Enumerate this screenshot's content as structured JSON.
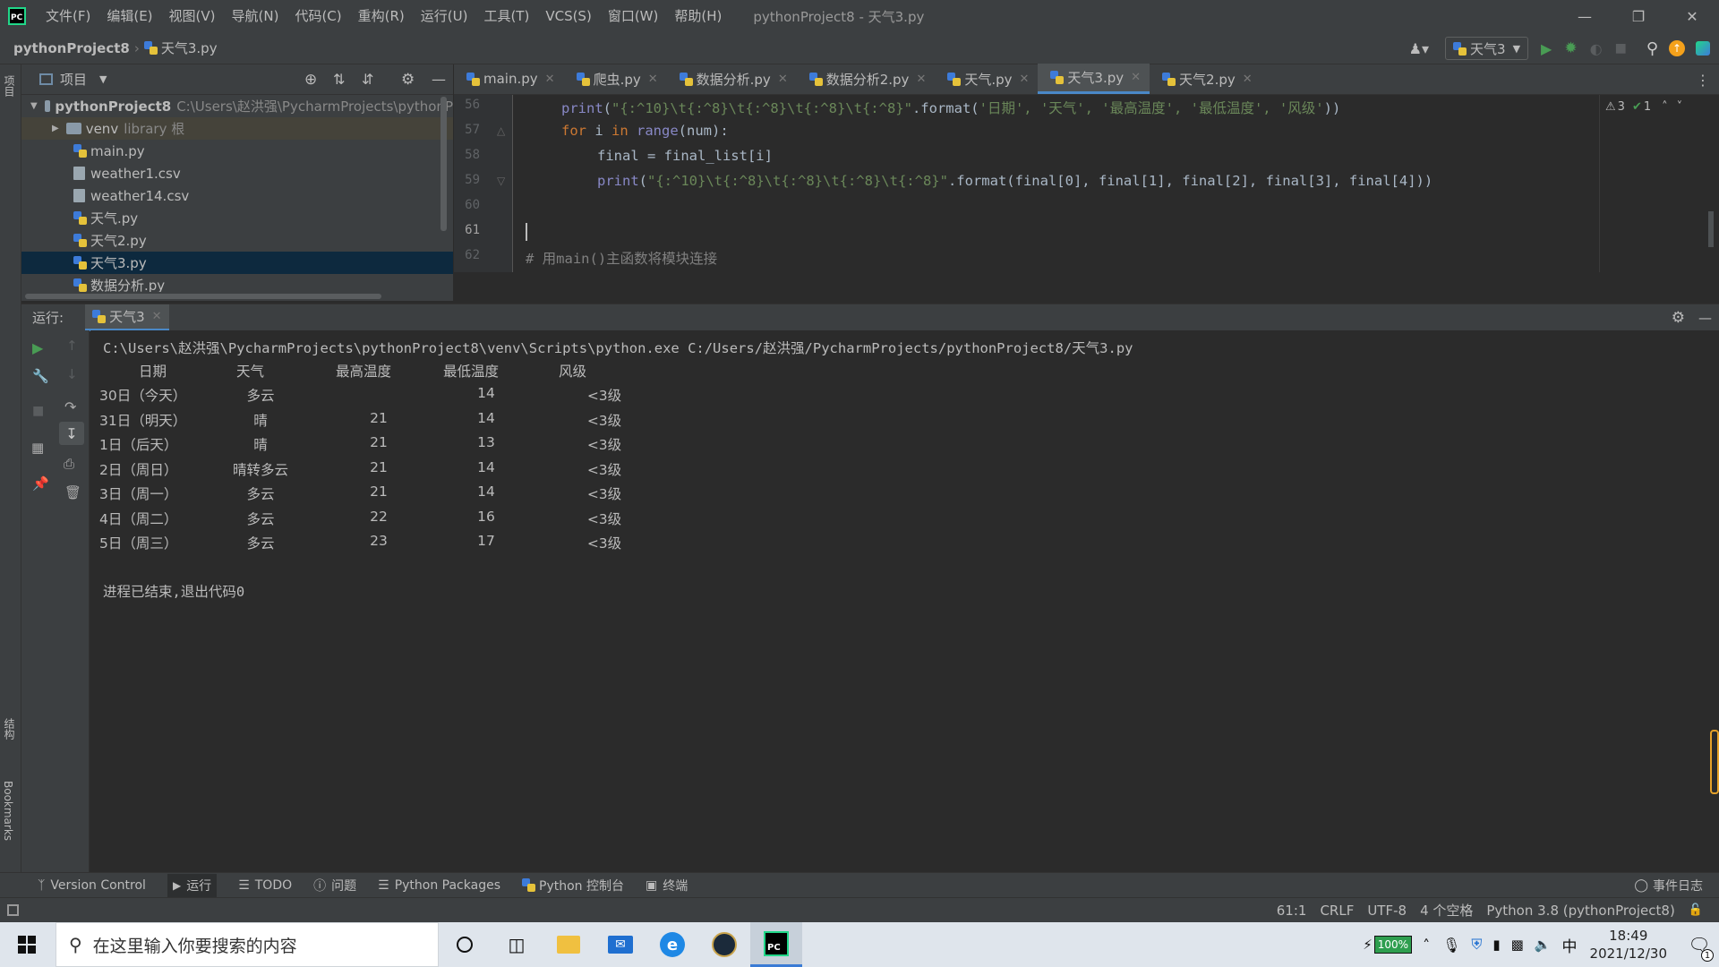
{
  "titlebar": {
    "menu": [
      "文件(F)",
      "编辑(E)",
      "视图(V)",
      "导航(N)",
      "代码(C)",
      "重构(R)",
      "运行(U)",
      "工具(T)",
      "VCS(S)",
      "窗口(W)",
      "帮助(H)"
    ],
    "window_title": "pythonProject8 - 天气3.py"
  },
  "navbar": {
    "project": "pythonProject8",
    "file": "天气3.py",
    "run_config": "天气3"
  },
  "sidebar_tabs": {
    "project": "项目",
    "structure": "结构",
    "bookmarks": "Bookmarks"
  },
  "project_panel": {
    "title": "项目",
    "root_name": "pythonProject8",
    "root_path": "C:\\Users\\赵洪强\\PycharmProjects\\pythonP",
    "venv": "venv",
    "venv_note": "library 根",
    "files": [
      "main.py",
      "weather1.csv",
      "weather14.csv",
      "天气.py",
      "天气2.py",
      "天气3.py",
      "数据分析.py"
    ],
    "selected": "天气3.py"
  },
  "editor": {
    "tabs": [
      "main.py",
      "爬虫.py",
      "数据分析.py",
      "数据分析2.py",
      "天气.py",
      "天气3.py",
      "天气2.py"
    ],
    "active_tab": "天气3.py",
    "line_numbers": [
      "56",
      "57",
      "58",
      "59",
      "60",
      "61",
      "62"
    ],
    "code": {
      "l56_fn": "print",
      "l56_a": "(",
      "l56_str": "\"{:^10}\\t{:^8}\\t{:^8}\\t{:^8}\\t{:^8}\"",
      "l56_b": ".format(",
      "l56_args": "'日期', '天气', '最高温度', '最低温度', '风级'",
      "l56_c": "))",
      "l57_kw1": "for",
      "l57_a": " i ",
      "l57_kw2": "in",
      "l57_bi": " range",
      "l57_b": "(num):",
      "l58": "final = final_list[i]",
      "l59_fn": "print",
      "l59_a": "(",
      "l59_str": "\"{:^10}\\t{:^8}\\t{:^8}\\t{:^8}\\t{:^8}\"",
      "l59_b": ".format(final[0], final[1], final[2], final[3], final[4]))",
      "l62": "# 用main()主函数将模块连接"
    },
    "inspections": {
      "warnings": "3",
      "ok": "1"
    }
  },
  "run_panel": {
    "label": "运行:",
    "tab": "天气3",
    "command": "C:\\Users\\赵洪强\\PycharmProjects\\pythonProject8\\venv\\Scripts\\python.exe C:/Users/赵洪强/PycharmProjects/pythonProject8/天气3.py",
    "headers": [
      "日期",
      "天气",
      "最高温度",
      "最低温度",
      "风级"
    ],
    "rows": [
      [
        "30日（今天）",
        "多云",
        "",
        "14",
        "<3级"
      ],
      [
        "31日（明天）",
        "晴",
        "21",
        "14",
        "<3级"
      ],
      [
        "1日（后天）",
        "晴",
        "21",
        "13",
        "<3级"
      ],
      [
        "2日（周日）",
        "晴转多云",
        "21",
        "14",
        "<3级"
      ],
      [
        "3日（周一）",
        "多云",
        "21",
        "14",
        "<3级"
      ],
      [
        "4日（周二）",
        "多云",
        "22",
        "16",
        "<3级"
      ],
      [
        "5日（周三）",
        "多云",
        "23",
        "17",
        "<3级"
      ]
    ],
    "exit_message": "进程已结束,退出代码0"
  },
  "tool_windows": [
    "Version Control",
    "运行",
    "TODO",
    "问题",
    "Python Packages",
    "Python 控制台",
    "终端"
  ],
  "event_log": "事件日志",
  "statusbar": {
    "position": "61:1",
    "line_sep": "CRLF",
    "encoding": "UTF-8",
    "indent": "4 个空格",
    "interpreter": "Python 3.8 (pythonProject8)"
  },
  "taskbar": {
    "search_placeholder": "在这里输入你要搜索的内容",
    "battery": "100%",
    "ime": "中",
    "time": "18:49",
    "date": "2021/12/30",
    "notifications": "1"
  },
  "colors": {
    "accent": "#4a88c7",
    "keyword": "#cc7832",
    "string": "#6a8759",
    "builtin": "#8888c6",
    "comment": "#808080",
    "run": "#499c54"
  }
}
